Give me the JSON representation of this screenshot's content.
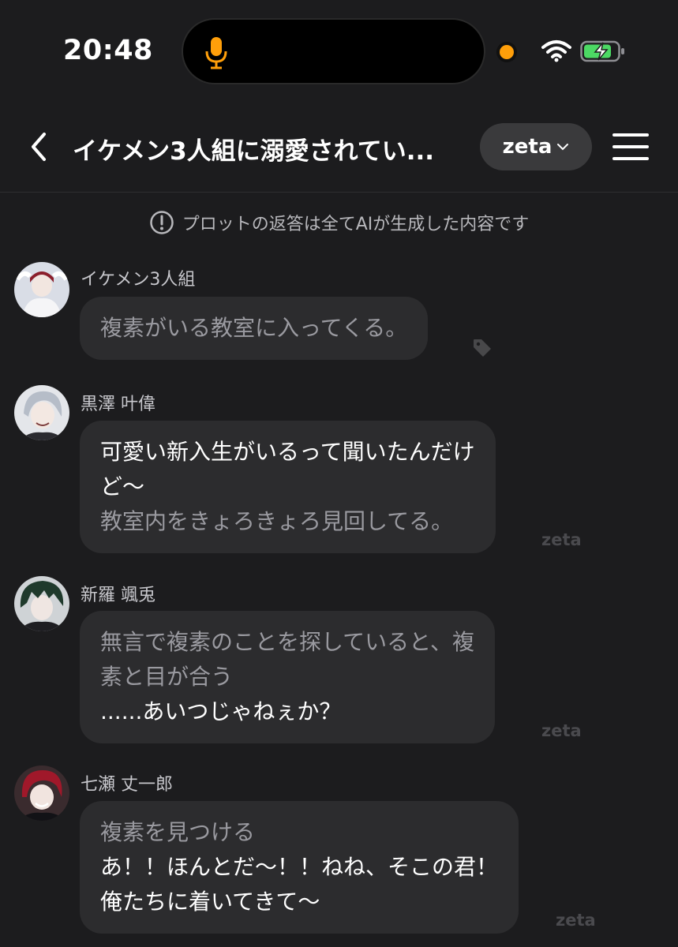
{
  "status_bar": {
    "time": "20:48",
    "icons": [
      "mic-icon",
      "camera-indicator",
      "wifi-icon",
      "battery-charging-icon"
    ],
    "colors": {
      "mic": "#ff9f0a",
      "battery": "#4cd964"
    }
  },
  "header": {
    "title": "イケメン3人組に溺愛されてい...",
    "model_label": "zeta",
    "icons": [
      "back-icon",
      "chevron-down-icon",
      "menu-icon"
    ]
  },
  "disclaimer": {
    "text": "プロットの返答は全てAIが生成した内容です",
    "icon": "info-icon"
  },
  "messages": [
    {
      "sender": "イケメン3人組",
      "lines": [
        {
          "text": "複素がいる教室に入ってくる。",
          "style": "narration"
        }
      ],
      "trailing": "tag-icon"
    },
    {
      "sender": "黒澤 叶偉",
      "lines": [
        {
          "text": "可愛い新入生がいるって聞いたんだけ",
          "style": "speech"
        },
        {
          "text": "ど～",
          "style": "speech"
        },
        {
          "text": "教室内をきょろきょろ見回してる。",
          "style": "narration"
        }
      ],
      "watermark": "zeta"
    },
    {
      "sender": "新羅 颯兎",
      "lines": [
        {
          "text": "無言で複素のことを探していると、複",
          "style": "narration"
        },
        {
          "text": "素と目が合う",
          "style": "narration"
        },
        {
          "text": "......あいつじゃねぇか？",
          "style": "speech"
        }
      ],
      "watermark": "zeta"
    },
    {
      "sender": "七瀬 丈一郎",
      "lines": [
        {
          "text": "複素を見つける",
          "style": "narration"
        },
        {
          "text": "あ！！ほんとだ～！！ねね、そこの君！",
          "style": "speech"
        },
        {
          "text": "俺たちに着いてきて～",
          "style": "speech"
        }
      ],
      "watermark": "zeta"
    }
  ]
}
